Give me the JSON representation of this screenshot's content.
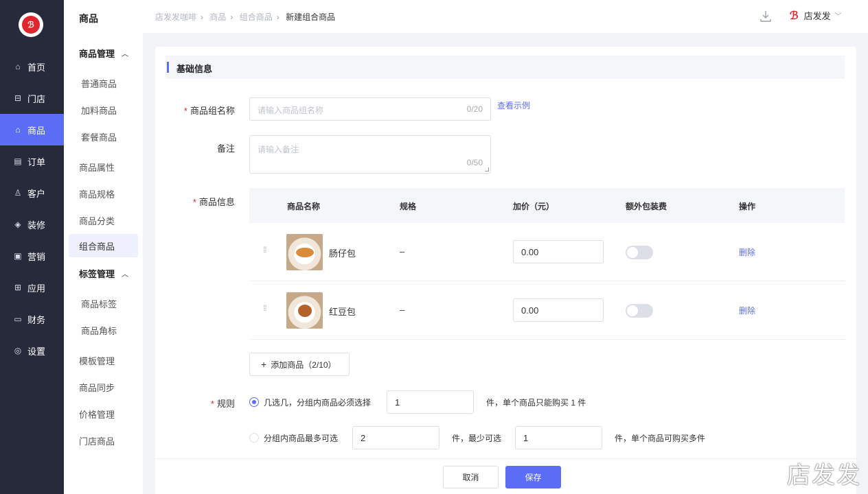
{
  "nav": {
    "items": [
      {
        "label": "首页",
        "icon": "home-icon"
      },
      {
        "label": "门店",
        "icon": "store-icon"
      },
      {
        "label": "商品",
        "icon": "bag-icon"
      },
      {
        "label": "订单",
        "icon": "order-icon"
      },
      {
        "label": "客户",
        "icon": "user-icon"
      },
      {
        "label": "装修",
        "icon": "layers-icon"
      },
      {
        "label": "营销",
        "icon": "gift-icon"
      },
      {
        "label": "应用",
        "icon": "apps-icon"
      },
      {
        "label": "财务",
        "icon": "card-icon"
      },
      {
        "label": "设置",
        "icon": "settings-icon"
      }
    ],
    "active": "商品"
  },
  "subnav": {
    "title": "商品",
    "group1": "商品管理",
    "group1_items": [
      "普通商品",
      "加料商品",
      "套餐商品"
    ],
    "items_mid": [
      "商品属性",
      "商品规格",
      "商品分类",
      "组合商品"
    ],
    "active": "组合商品",
    "group2": "标签管理",
    "group2_items": [
      "商品标签",
      "商品角标"
    ],
    "items_bottom": [
      "模板管理",
      "商品同步",
      "价格管理",
      "门店商品"
    ]
  },
  "header": {
    "breadcrumb": [
      "店发发咖啡",
      "商品",
      "组合商品",
      "新建组合商品"
    ],
    "user": "店发发"
  },
  "form": {
    "section_title": "基础信息",
    "name_label": "商品组名称",
    "name_placeholder": "请输入商品组名称",
    "name_count": "0/20",
    "example_link": "查看示例",
    "note_label": "备注",
    "note_placeholder": "请输入备注",
    "note_count": "0/50",
    "info_label": "商品信息",
    "table_headers": [
      "商品名称",
      "规格",
      "加价（元）",
      "额外包装费",
      "操作"
    ],
    "products": [
      {
        "name": "肠仔包",
        "spec": "–",
        "price": "0.00",
        "packaging_fee": false,
        "action": "删除"
      },
      {
        "name": "红豆包",
        "spec": "–",
        "price": "0.00",
        "packaging_fee": false,
        "action": "删除"
      }
    ],
    "add_button": "添加商品（2/10）",
    "rule_label": "规则",
    "rule1_text": "几选几，分组内商品必须选择",
    "rule1_value": "1",
    "rule1_suffix": "件，单个商品只能购买 1 件",
    "rule2_text": "分组内商品最多可选",
    "rule2_value": "2",
    "rule2_mid": "件，最少可选",
    "rule2_min": "1",
    "rule2_suffix": "件，单个商品可购买多件",
    "selected_rule": 1
  },
  "footer": {
    "cancel": "取消",
    "save": "保存"
  },
  "colors": {
    "accent": "#5b6cf5",
    "nav_bg": "#262a3b",
    "required": "#e0262d"
  }
}
